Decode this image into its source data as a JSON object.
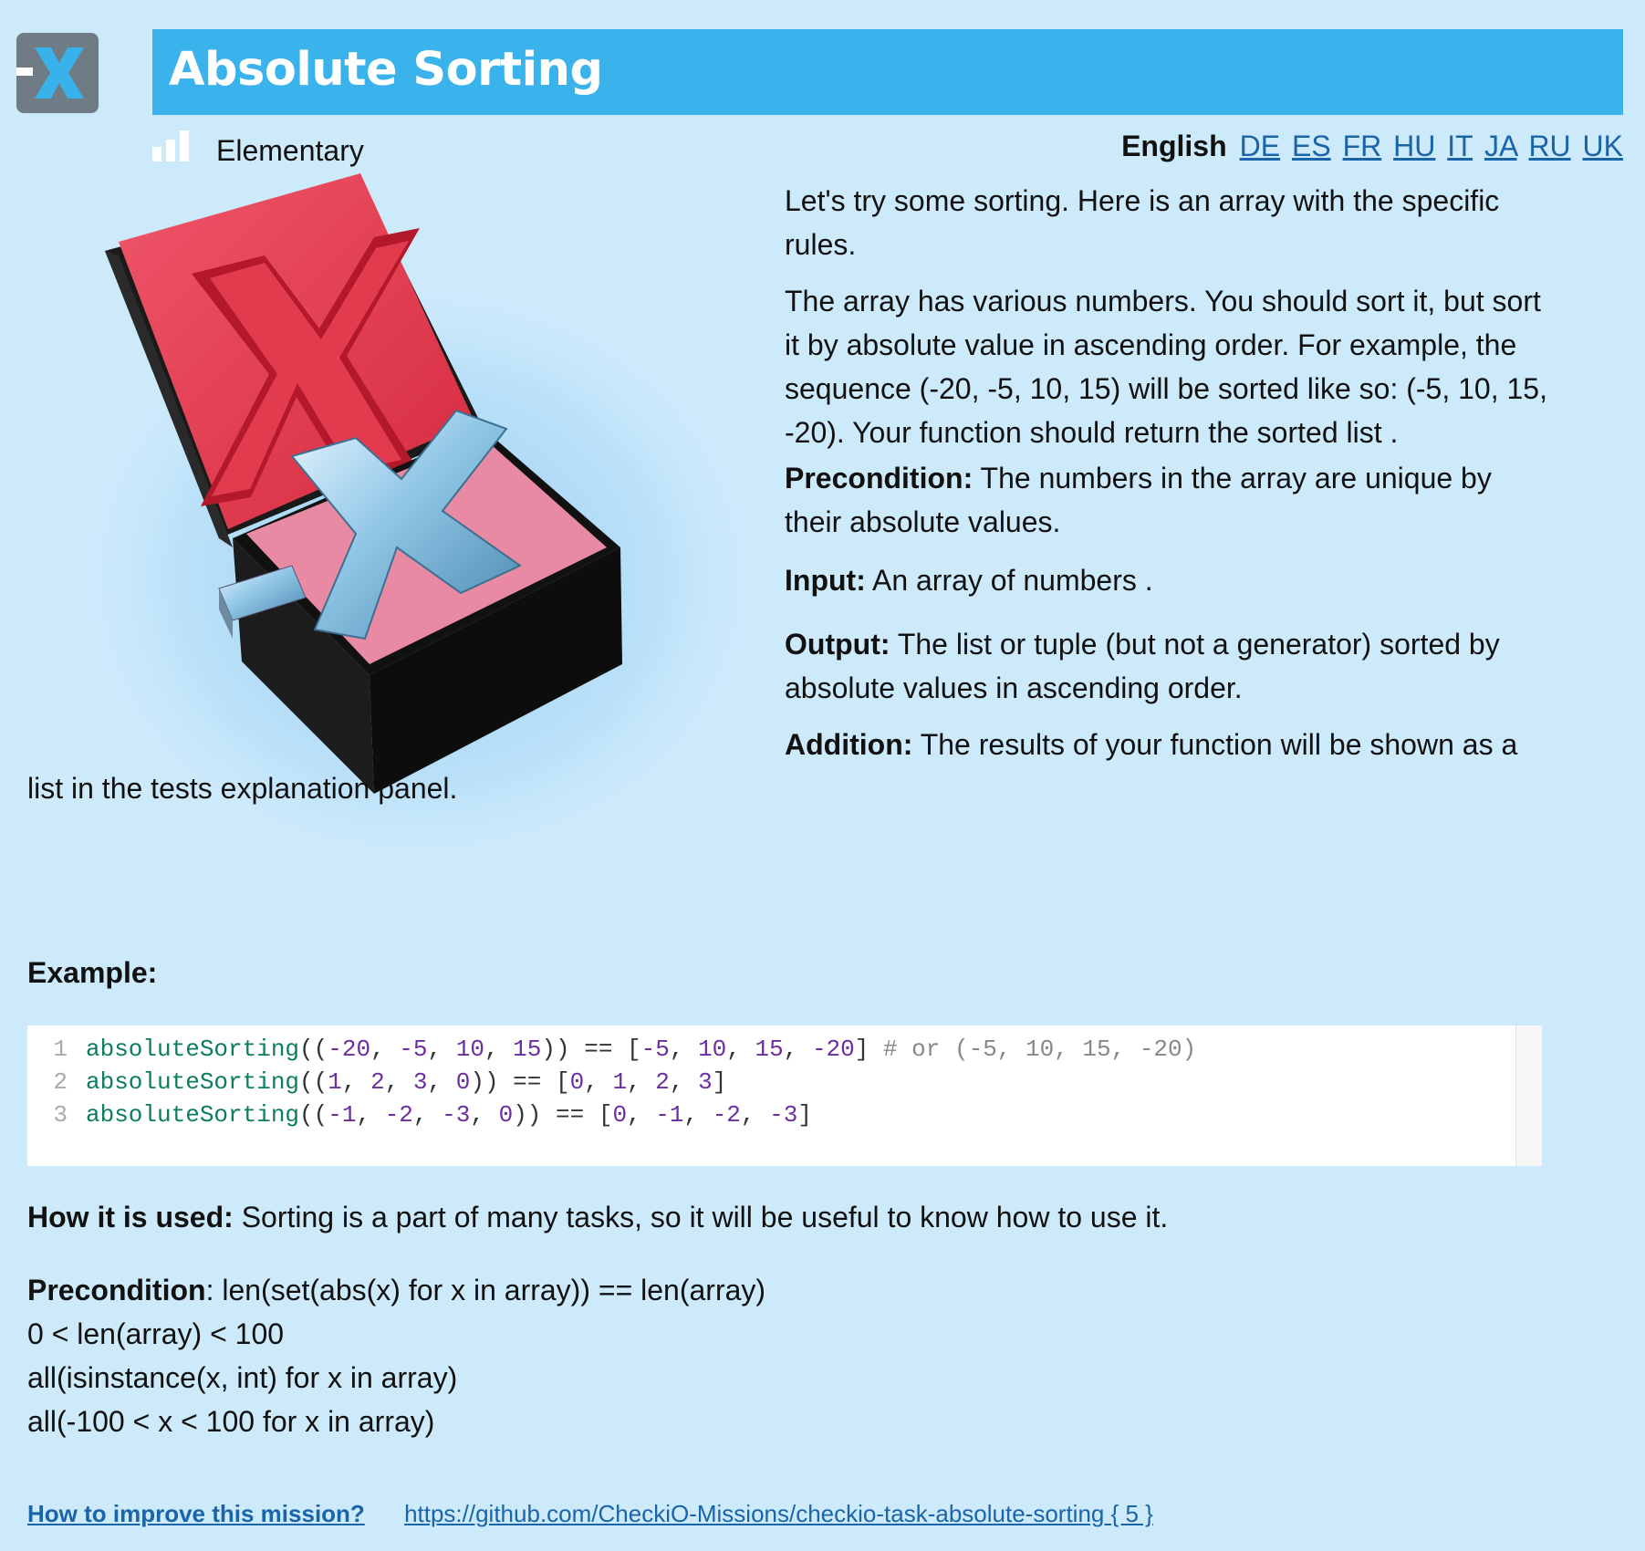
{
  "mission": {
    "title": "Absolute Sorting",
    "difficulty": "Elementary"
  },
  "languages": {
    "current": "English",
    "others": [
      "DE",
      "ES",
      "FR",
      "HU",
      "IT",
      "JA",
      "RU",
      "UK"
    ]
  },
  "description": {
    "intro": "Let's try some sorting. Here is an array with the specific rules.",
    "body_1": "The array has various numbers. You should sort it, but sort",
    "body_2": "it by absolute value in ascending order. For example, the",
    "body_3": "sequence (-20, -5, 10, 15) will be sorted like so: (-5, 10, 15,",
    "body_4": "-20). Your function should return the sorted list .",
    "precondition_label": "Precondition:",
    "precondition_text": "The numbers in the array are unique by their absolute values.",
    "input_label": "Input:",
    "input_text": "An array of numbers .",
    "output_label": "Output:",
    "output_text": "The list or tuple (but not a generator) sorted by absolute values in ascending order.",
    "addition_label": "Addition:",
    "addition_text_1": "The results of your function will be shown as a",
    "addition_text_2": "list in the tests explanation panel.",
    "example_label": "Example:",
    "usage_label": "How it is used:",
    "usage_text": "Sorting is a part of many tasks, so it will be useful to know how to use it.",
    "precond2_label": "Precondition",
    "precond2_line1": ": len(set(abs(x) for x in array)) == len(array)",
    "precond2_line2": "0 < len(array) < 100",
    "precond2_line3": "all(isinstance(x, int) for x in array)",
    "precond2_line4": "all(-100 < x < 100 for x in array)"
  },
  "code_lines": [
    {
      "n": "1",
      "fn": "absoluteSorting",
      "args": [
        "-20",
        "-5",
        "10",
        "15"
      ],
      "result": [
        "-5",
        "10",
        "15",
        "-20"
      ],
      "comment": "# or (-5, 10, 15, -20)"
    },
    {
      "n": "2",
      "fn": "absoluteSorting",
      "args": [
        "1",
        "2",
        "3",
        "0"
      ],
      "result": [
        "0",
        "1",
        "2",
        "3"
      ],
      "comment": ""
    },
    {
      "n": "3",
      "fn": "absoluteSorting",
      "args": [
        "-1",
        "-2",
        "-3",
        "0"
      ],
      "result": [
        "0",
        "-1",
        "-2",
        "-3"
      ],
      "comment": ""
    }
  ],
  "footer": {
    "improve_label": "How to improve this mission?",
    "repo_link": "https://github.com/CheckiO-Missions/checkio-task-absolute-sorting { 5 }"
  },
  "colors": {
    "background": "#cdeafb",
    "title_bar": "#3ab3ec",
    "link": "#1a64a8",
    "code_function": "#0c7d5f",
    "code_number": "#6b2fa0"
  },
  "icons": {
    "logo": "checkio-x-logo",
    "difficulty": "difficulty-bars-icon",
    "illustration": "checkio-x-boxes-illustration"
  }
}
